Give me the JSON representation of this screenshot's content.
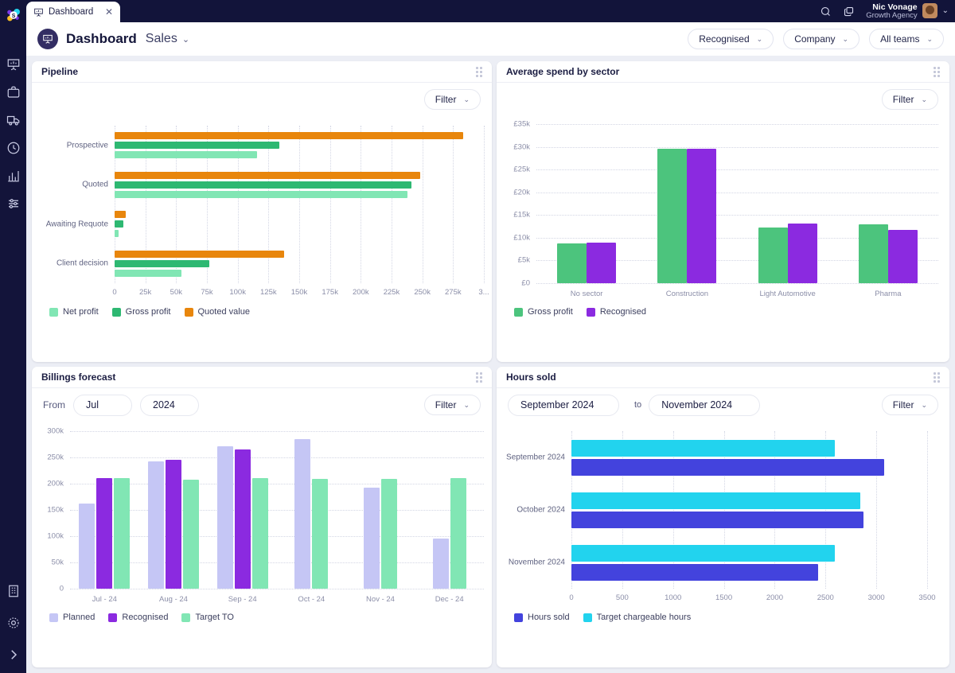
{
  "app": {
    "logo_icon": "app-logo-icon",
    "tab": {
      "label": "Dashboard",
      "icon": "presentation-chart-icon",
      "close": "✕"
    },
    "topbar_icons": {
      "search": "search-icon",
      "windows": "windows-copy-icon",
      "caret": "⌄"
    },
    "user": {
      "name": "Nic Vonage",
      "org": "Growth Agency"
    }
  },
  "header": {
    "badge_icon": "presentation-chart-icon",
    "title": "Dashboard",
    "subtitle": "Sales",
    "subtitle_caret": "⌄",
    "filters": [
      {
        "label": "Recognised",
        "caret": "⌄"
      },
      {
        "label": "Company",
        "caret": "⌄"
      },
      {
        "label": "All teams",
        "caret": "⌄"
      }
    ]
  },
  "sidebar": {
    "items": [
      {
        "icon": "presentation-chart-icon"
      },
      {
        "icon": "briefcase-icon"
      },
      {
        "icon": "truck-icon"
      },
      {
        "icon": "clock-icon"
      },
      {
        "icon": "bar-chart-icon"
      },
      {
        "icon": "sliders-icon"
      }
    ],
    "bottom": [
      {
        "icon": "building-icon"
      },
      {
        "icon": "gear-icon"
      },
      {
        "icon": "chevron-right-icon"
      }
    ]
  },
  "panels": {
    "pipeline": {
      "title": "Pipeline",
      "filter_label": "Filter",
      "caret": "⌄"
    },
    "sector": {
      "title": "Average spend by sector",
      "filter_label": "Filter",
      "caret": "⌄"
    },
    "billings": {
      "title": "Billings forecast",
      "filter_label": "Filter",
      "caret": "⌄",
      "from_label": "From",
      "month_value": "Jul",
      "year_value": "2024"
    },
    "hours": {
      "title": "Hours sold",
      "filter_label": "Filter",
      "caret": "⌄",
      "from_value": "September 2024",
      "to_label": "to",
      "to_value": "November 2024"
    }
  },
  "chart_data": [
    {
      "id": "pipeline",
      "type": "bar",
      "orientation": "horizontal",
      "title": "Pipeline",
      "xlabel": "",
      "ylabel": "",
      "categories": [
        "Prospective",
        "Quoted",
        "Awaiting Requote",
        "Client decision"
      ],
      "xlim": [
        0,
        300000
      ],
      "xticks": [
        0,
        25000,
        50000,
        75000,
        100000,
        125000,
        150000,
        175000,
        200000,
        225000,
        250000,
        275000,
        300000
      ],
      "xticklabels": [
        "0",
        "25k",
        "50k",
        "75k",
        "100k",
        "125k",
        "150k",
        "175k",
        "200k",
        "225k",
        "250k",
        "275k",
        "3..."
      ],
      "grid": true,
      "legend_position": "bottom-left",
      "series": [
        {
          "name": "Quoted value",
          "color": "#e8860c",
          "values": [
            283000,
            248000,
            9000,
            138000
          ]
        },
        {
          "name": "Gross profit",
          "color": "#2eb872",
          "values": [
            134000,
            241000,
            7000,
            77000
          ]
        },
        {
          "name": "Net profit",
          "color": "#81e6b4",
          "values": [
            116000,
            238000,
            3500,
            54000
          ]
        }
      ],
      "legend": [
        {
          "name": "Net profit",
          "color": "#81e6b4"
        },
        {
          "name": "Gross profit",
          "color": "#2eb872"
        },
        {
          "name": "Quoted value",
          "color": "#e8860c"
        }
      ]
    },
    {
      "id": "sector",
      "type": "bar",
      "orientation": "vertical",
      "title": "Average spend by sector",
      "xlabel": "",
      "ylabel": "",
      "categories": [
        "No sector",
        "Construction",
        "Light Automotive",
        "Pharma"
      ],
      "ylim": [
        0,
        35000
      ],
      "yticks": [
        0,
        5000,
        10000,
        15000,
        20000,
        25000,
        30000,
        35000
      ],
      "yticklabels": [
        "£0",
        "£5k",
        "£10k",
        "£15k",
        "£20k",
        "£25k",
        "£30k",
        "£35k"
      ],
      "grid": true,
      "legend_position": "bottom-left",
      "series": [
        {
          "name": "Gross profit",
          "color": "#4cc47d",
          "values": [
            8700,
            29500,
            12200,
            12900
          ]
        },
        {
          "name": "Recognised",
          "color": "#8b2ae0",
          "values": [
            8900,
            29500,
            13200,
            11800
          ]
        }
      ],
      "legend": [
        {
          "name": "Gross profit",
          "color": "#4cc47d"
        },
        {
          "name": "Recognised",
          "color": "#8b2ae0"
        }
      ]
    },
    {
      "id": "billings",
      "type": "bar",
      "orientation": "vertical",
      "title": "Billings forecast",
      "xlabel": "",
      "ylabel": "",
      "categories": [
        "Jul - 24",
        "Aug - 24",
        "Sep - 24",
        "Oct - 24",
        "Nov - 24",
        "Dec - 24"
      ],
      "ylim": [
        0,
        300000
      ],
      "yticks": [
        0,
        50000,
        100000,
        150000,
        200000,
        250000,
        300000
      ],
      "yticklabels": [
        "0",
        "50k",
        "100k",
        "150k",
        "200k",
        "250k",
        "300k"
      ],
      "grid": true,
      "legend_position": "bottom-left",
      "series": [
        {
          "name": "Planned",
          "color": "#c5c6f5",
          "values": [
            162000,
            242000,
            271000,
            285000,
            193000,
            95000
          ]
        },
        {
          "name": "Recognised",
          "color": "#8b2ae0",
          "values": [
            211000,
            245000,
            265000,
            null,
            null,
            null
          ]
        },
        {
          "name": "Target TO",
          "color": "#81e6b4",
          "values": [
            210000,
            208000,
            210000,
            209000,
            209000,
            210000
          ]
        }
      ],
      "legend": [
        {
          "name": "Planned",
          "color": "#c5c6f5"
        },
        {
          "name": "Recognised",
          "color": "#8b2ae0"
        },
        {
          "name": "Target TO",
          "color": "#81e6b4"
        }
      ]
    },
    {
      "id": "hours",
      "type": "bar",
      "orientation": "horizontal",
      "title": "Hours sold",
      "xlabel": "",
      "ylabel": "",
      "categories": [
        "September 2024",
        "October 2024",
        "November 2024"
      ],
      "xlim": [
        0,
        3500
      ],
      "xticks": [
        0,
        500,
        1000,
        1500,
        2000,
        2500,
        3000,
        3500
      ],
      "xticklabels": [
        "0",
        "500",
        "1000",
        "1500",
        "2000",
        "2500",
        "3000",
        "3500"
      ],
      "grid": true,
      "legend_position": "bottom-left",
      "series": [
        {
          "name": "Target chargeable hours",
          "color": "#22d3ee",
          "values": [
            2590,
            2840,
            2595
          ]
        },
        {
          "name": "Hours sold",
          "color": "#4343dd",
          "values": [
            3080,
            2875,
            2425
          ]
        }
      ],
      "legend": [
        {
          "name": "Hours sold",
          "color": "#4343dd"
        },
        {
          "name": "Target chargeable hours",
          "color": "#22d3ee"
        }
      ]
    }
  ]
}
